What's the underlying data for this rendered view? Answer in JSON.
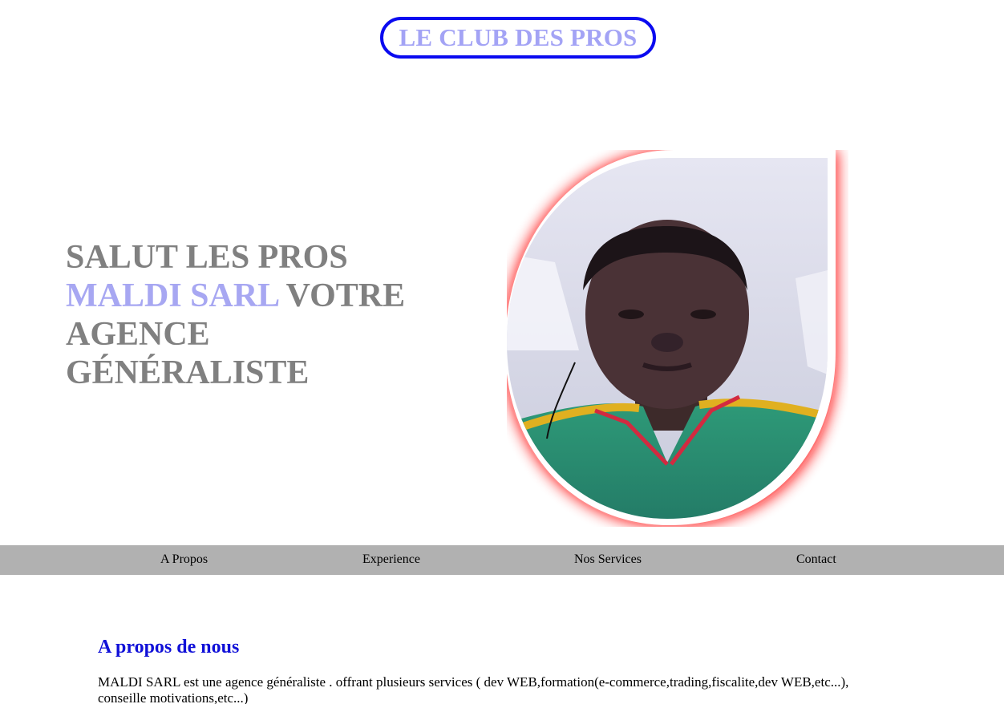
{
  "brand": {
    "title": "LE CLUB DES PROS"
  },
  "hero": {
    "line1": "SALUT LES PROS",
    "highlight": "MALDI SARL",
    "line2_rest": " VOTRE",
    "line3": "AGENCE",
    "line4": "GÉNÉRALISTE"
  },
  "nav": {
    "items": [
      {
        "label": "A Propos"
      },
      {
        "label": "Experience"
      },
      {
        "label": "Nos Services"
      },
      {
        "label": "Contact"
      }
    ]
  },
  "about": {
    "title": "A propos de nous",
    "text": "MALDI SARL est une agence généraliste . offrant plusieurs services ( dev WEB,formation(e-commerce,trading,fiscalite,dev WEB,etc...), conseille motivations,etc...)"
  },
  "colors": {
    "brand_border": "#0a0af0",
    "brand_text": "#a3a3f5",
    "hero_text": "#808080",
    "hero_accent": "#a7a7f2",
    "frame_glow": "#ff0000",
    "nav_bg": "#b1b1b1",
    "section_title": "#1010d8"
  }
}
